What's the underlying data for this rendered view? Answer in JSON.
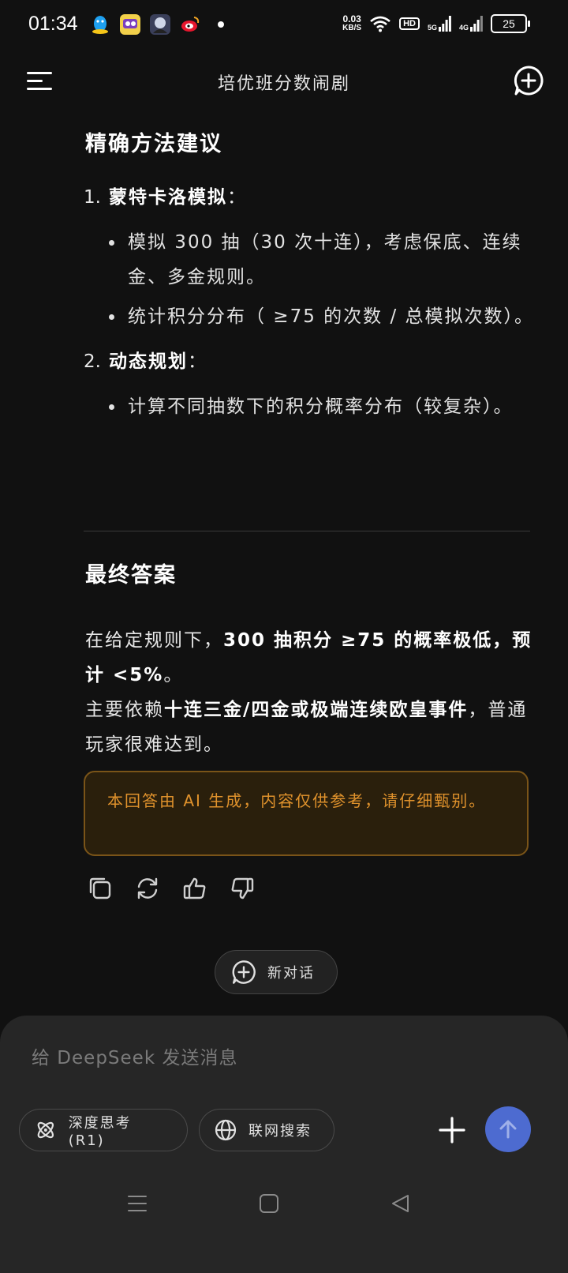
{
  "status_bar": {
    "time": "01:34",
    "net_speed_value": "0.03",
    "net_speed_unit": "KB/S",
    "hd_label": "HD",
    "signal_5g": "5G",
    "signal_4g": "4G",
    "battery": "25"
  },
  "header": {
    "title": "培优班分数闹剧"
  },
  "content": {
    "section1_heading": "精确方法建议",
    "list": [
      {
        "num": "1.",
        "title": "蒙特卡洛模拟",
        "colon": "：",
        "bullets": [
          "模拟 300 抽（30 次十连），考虑保底、连续金、多金规则。",
          "统计积分分布（ ≥75 的次数 / 总模拟次数）。"
        ]
      },
      {
        "num": "2.",
        "title": "动态规划",
        "colon": "：",
        "bullets": [
          "计算不同抽数下的积分概率分布（较复杂）。"
        ]
      }
    ],
    "section2_heading": "最终答案",
    "para1_prefix": "在给定规则下，",
    "para1_bold": "300 抽积分 ≥75 的概率极低，预计 <5%",
    "para1_suffix": "。",
    "para2_prefix": "主要依赖",
    "para2_bold": "十连三金/四金或极端连续欧皇事件",
    "para2_suffix": "，普通玩家很难达到。"
  },
  "disclaimer": "本回答由 AI 生成，内容仅供参考，请仔细甄别。",
  "new_chat_label": "新对话",
  "input": {
    "placeholder": "给 DeepSeek 发送消息"
  },
  "chips": {
    "deep_think": "深度思考 (R1)",
    "web_search": "联网搜索"
  },
  "colors": {
    "background": "#111111",
    "accent": "#4d6bd0",
    "disclaimer_text": "#e0922c",
    "disclaimer_border": "#7a5418"
  }
}
